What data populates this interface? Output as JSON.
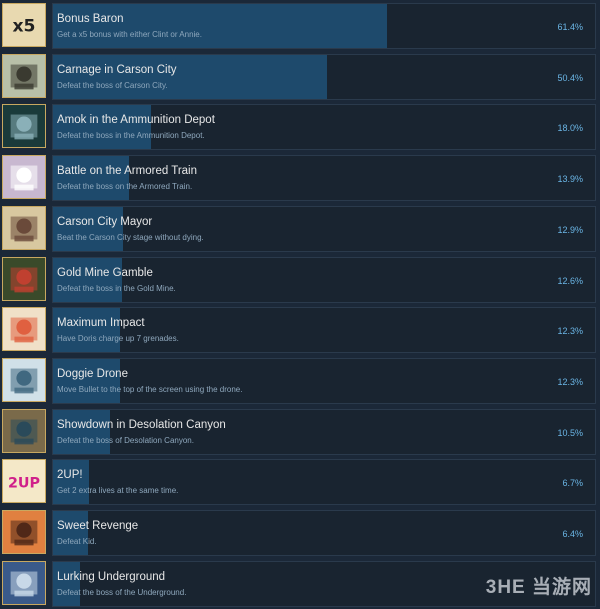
{
  "achievements": [
    {
      "title": "Bonus Baron",
      "description": "Get a x5 bonus with either Clint or Annie.",
      "percent_label": "61.4%",
      "percent": 61.4,
      "icon": "x5-bonus-icon",
      "icon_text": "x5",
      "icon_bg": "#e8d9b0",
      "icon_fg": "#222222"
    },
    {
      "title": "Carnage in Carson City",
      "description": "Defeat the boss of Carson City.",
      "percent_label": "50.4%",
      "percent": 50.4,
      "icon": "robot-boss-icon",
      "icon_bg": "#b8c0a8",
      "icon_fg": "#3a3a30"
    },
    {
      "title": "Amok in the Ammunition Depot",
      "description": "Defeat the boss in the Ammunition Depot.",
      "percent_label": "18.0%",
      "percent": 18.0,
      "icon": "mech-boss-icon",
      "icon_bg": "#1a3a3a",
      "icon_fg": "#8ab0b8"
    },
    {
      "title": "Battle on the Armored Train",
      "description": "Defeat the boss on the Armored Train.",
      "percent_label": "13.9%",
      "percent": 13.9,
      "icon": "skull-boss-icon",
      "icon_bg": "#c8b8d0",
      "icon_fg": "#ffffff"
    },
    {
      "title": "Carson City Mayor",
      "description": "Beat the Carson City stage without dying.",
      "percent_label": "12.9%",
      "percent": 12.9,
      "icon": "saloon-building-icon",
      "icon_bg": "#d8c8a0",
      "icon_fg": "#6a4a3a"
    },
    {
      "title": "Gold Mine Gamble",
      "description": "Defeat the boss in the Gold Mine.",
      "percent_label": "12.6%",
      "percent": 12.6,
      "icon": "mine-boss-icon",
      "icon_bg": "#3a4a2a",
      "icon_fg": "#c04030"
    },
    {
      "title": "Maximum Impact",
      "description": "Have Doris charge up 7 grenades.",
      "percent_label": "12.3%",
      "percent": 12.3,
      "icon": "grenades-icon",
      "icon_bg": "#f0e0c8",
      "icon_fg": "#e06040"
    },
    {
      "title": "Doggie Drone",
      "description": "Move Bullet to the top of the screen using the drone.",
      "percent_label": "12.3%",
      "percent": 12.3,
      "icon": "dog-drone-icon",
      "icon_bg": "#d0e0e8",
      "icon_fg": "#406880"
    },
    {
      "title": "Showdown in Desolation Canyon",
      "description": "Defeat the boss of Desolation Canyon.",
      "percent_label": "10.5%",
      "percent": 10.5,
      "icon": "canyon-boss-icon",
      "icon_bg": "#7a6a4a",
      "icon_fg": "#2a4a5a"
    },
    {
      "title": "2UP!",
      "description": "Get 2 extra lives at the same time.",
      "percent_label": "6.7%",
      "percent": 6.7,
      "icon": "2up-icon",
      "icon_text": "2UP",
      "icon_bg": "#f4e8c8",
      "icon_fg": "#d0208a"
    },
    {
      "title": "Sweet Revenge",
      "description": "Defeat Kid.",
      "percent_label": "6.4%",
      "percent": 6.4,
      "icon": "duel-icon",
      "icon_bg": "#e08040",
      "icon_fg": "#502818"
    },
    {
      "title": "Lurking Underground",
      "description": "Defeat the boss of the Underground.",
      "percent_label": "",
      "percent": 4.9,
      "icon": "underground-boss-icon",
      "icon_bg": "#3a5a8a",
      "icon_fg": "#c8d8e8"
    }
  ],
  "colors": {
    "background": "#1b2838",
    "bar": "#1e4a6c",
    "percent_text": "#6bb6e6"
  },
  "watermark": {
    "logo": "3HE 当游网",
    "url": "www.3dmgame.com"
  }
}
